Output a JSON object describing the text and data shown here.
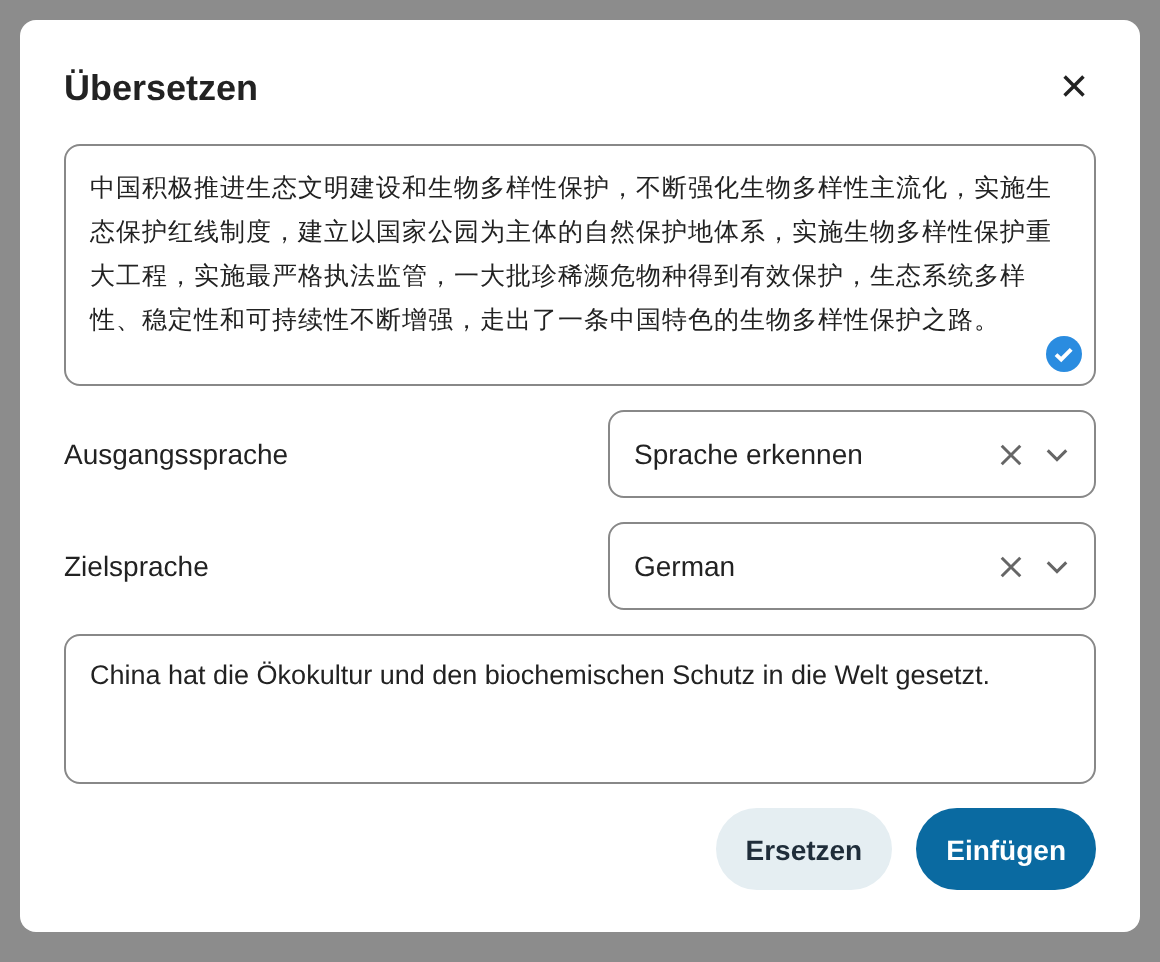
{
  "dialog": {
    "title": "Übersetzen",
    "close": "×"
  },
  "source_text": {
    "value": "中国积极推进生态文明建设和生物多样性保护，不断强化生物多样性主流化，实施生态保护红线制度，建立以国家公园为主体的自然保护地体系，实施生物多样性保护重大工程，实施最严格执法监管，一大批珍稀濒危物种得到有效保护，生态系统多样性、稳定性和可持续性不断增强，走出了一条中国特色的生物多样性保护之路。",
    "verified": true
  },
  "fields": [
    {
      "label": "Ausgangssprache",
      "value": "Sprache erkennen"
    },
    {
      "label": "Zielsprache",
      "value": "German"
    }
  ],
  "result_text": {
    "value": "China hat die Ökokultur und den biochemischen Schutz in die Welt gesetzt."
  },
  "buttons": [
    {
      "label": "Ersetzen",
      "kind": "secondary"
    },
    {
      "label": "Einfügen",
      "kind": "primary"
    }
  ]
}
